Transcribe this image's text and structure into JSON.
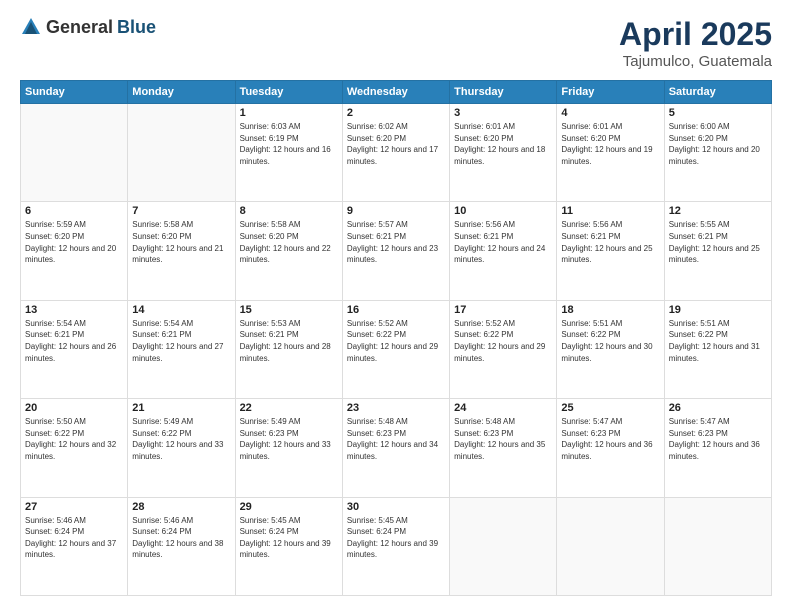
{
  "header": {
    "logo_general": "General",
    "logo_blue": "Blue",
    "month_title": "April 2025",
    "subtitle": "Tajumulco, Guatemala"
  },
  "weekdays": [
    "Sunday",
    "Monday",
    "Tuesday",
    "Wednesday",
    "Thursday",
    "Friday",
    "Saturday"
  ],
  "weeks": [
    [
      {
        "day": "",
        "info": ""
      },
      {
        "day": "",
        "info": ""
      },
      {
        "day": "1",
        "info": "Sunrise: 6:03 AM\nSunset: 6:19 PM\nDaylight: 12 hours and 16 minutes."
      },
      {
        "day": "2",
        "info": "Sunrise: 6:02 AM\nSunset: 6:20 PM\nDaylight: 12 hours and 17 minutes."
      },
      {
        "day": "3",
        "info": "Sunrise: 6:01 AM\nSunset: 6:20 PM\nDaylight: 12 hours and 18 minutes."
      },
      {
        "day": "4",
        "info": "Sunrise: 6:01 AM\nSunset: 6:20 PM\nDaylight: 12 hours and 19 minutes."
      },
      {
        "day": "5",
        "info": "Sunrise: 6:00 AM\nSunset: 6:20 PM\nDaylight: 12 hours and 20 minutes."
      }
    ],
    [
      {
        "day": "6",
        "info": "Sunrise: 5:59 AM\nSunset: 6:20 PM\nDaylight: 12 hours and 20 minutes."
      },
      {
        "day": "7",
        "info": "Sunrise: 5:58 AM\nSunset: 6:20 PM\nDaylight: 12 hours and 21 minutes."
      },
      {
        "day": "8",
        "info": "Sunrise: 5:58 AM\nSunset: 6:20 PM\nDaylight: 12 hours and 22 minutes."
      },
      {
        "day": "9",
        "info": "Sunrise: 5:57 AM\nSunset: 6:21 PM\nDaylight: 12 hours and 23 minutes."
      },
      {
        "day": "10",
        "info": "Sunrise: 5:56 AM\nSunset: 6:21 PM\nDaylight: 12 hours and 24 minutes."
      },
      {
        "day": "11",
        "info": "Sunrise: 5:56 AM\nSunset: 6:21 PM\nDaylight: 12 hours and 25 minutes."
      },
      {
        "day": "12",
        "info": "Sunrise: 5:55 AM\nSunset: 6:21 PM\nDaylight: 12 hours and 25 minutes."
      }
    ],
    [
      {
        "day": "13",
        "info": "Sunrise: 5:54 AM\nSunset: 6:21 PM\nDaylight: 12 hours and 26 minutes."
      },
      {
        "day": "14",
        "info": "Sunrise: 5:54 AM\nSunset: 6:21 PM\nDaylight: 12 hours and 27 minutes."
      },
      {
        "day": "15",
        "info": "Sunrise: 5:53 AM\nSunset: 6:21 PM\nDaylight: 12 hours and 28 minutes."
      },
      {
        "day": "16",
        "info": "Sunrise: 5:52 AM\nSunset: 6:22 PM\nDaylight: 12 hours and 29 minutes."
      },
      {
        "day": "17",
        "info": "Sunrise: 5:52 AM\nSunset: 6:22 PM\nDaylight: 12 hours and 29 minutes."
      },
      {
        "day": "18",
        "info": "Sunrise: 5:51 AM\nSunset: 6:22 PM\nDaylight: 12 hours and 30 minutes."
      },
      {
        "day": "19",
        "info": "Sunrise: 5:51 AM\nSunset: 6:22 PM\nDaylight: 12 hours and 31 minutes."
      }
    ],
    [
      {
        "day": "20",
        "info": "Sunrise: 5:50 AM\nSunset: 6:22 PM\nDaylight: 12 hours and 32 minutes."
      },
      {
        "day": "21",
        "info": "Sunrise: 5:49 AM\nSunset: 6:22 PM\nDaylight: 12 hours and 33 minutes."
      },
      {
        "day": "22",
        "info": "Sunrise: 5:49 AM\nSunset: 6:23 PM\nDaylight: 12 hours and 33 minutes."
      },
      {
        "day": "23",
        "info": "Sunrise: 5:48 AM\nSunset: 6:23 PM\nDaylight: 12 hours and 34 minutes."
      },
      {
        "day": "24",
        "info": "Sunrise: 5:48 AM\nSunset: 6:23 PM\nDaylight: 12 hours and 35 minutes."
      },
      {
        "day": "25",
        "info": "Sunrise: 5:47 AM\nSunset: 6:23 PM\nDaylight: 12 hours and 36 minutes."
      },
      {
        "day": "26",
        "info": "Sunrise: 5:47 AM\nSunset: 6:23 PM\nDaylight: 12 hours and 36 minutes."
      }
    ],
    [
      {
        "day": "27",
        "info": "Sunrise: 5:46 AM\nSunset: 6:24 PM\nDaylight: 12 hours and 37 minutes."
      },
      {
        "day": "28",
        "info": "Sunrise: 5:46 AM\nSunset: 6:24 PM\nDaylight: 12 hours and 38 minutes."
      },
      {
        "day": "29",
        "info": "Sunrise: 5:45 AM\nSunset: 6:24 PM\nDaylight: 12 hours and 39 minutes."
      },
      {
        "day": "30",
        "info": "Sunrise: 5:45 AM\nSunset: 6:24 PM\nDaylight: 12 hours and 39 minutes."
      },
      {
        "day": "",
        "info": ""
      },
      {
        "day": "",
        "info": ""
      },
      {
        "day": "",
        "info": ""
      }
    ]
  ]
}
